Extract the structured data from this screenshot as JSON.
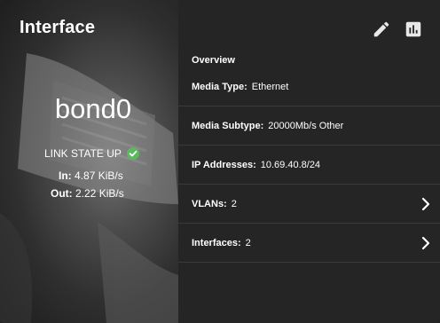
{
  "card": {
    "title": "Interface",
    "interface_name": "bond0",
    "link_state": "LINK STATE UP",
    "in_label": "In:",
    "in_value": "4.87 KiB/s",
    "out_label": "Out:",
    "out_value": "2.22 KiB/s",
    "status_color": "#5cb85c"
  },
  "toolbar": {
    "edit_icon": "pencil-icon",
    "chart_icon": "bar-chart-icon"
  },
  "details": {
    "overview_label": "Overview",
    "media_type_label": "Media Type:",
    "media_type_value": "Ethernet",
    "media_subtype_label": "Media Subtype:",
    "media_subtype_value": "20000Mb/s Other",
    "ip_label": "IP Addresses:",
    "ip_value": "10.69.40.8/24",
    "vlans_label": "VLANs:",
    "vlans_value": "2",
    "interfaces_label": "Interfaces:",
    "interfaces_value": "2"
  }
}
